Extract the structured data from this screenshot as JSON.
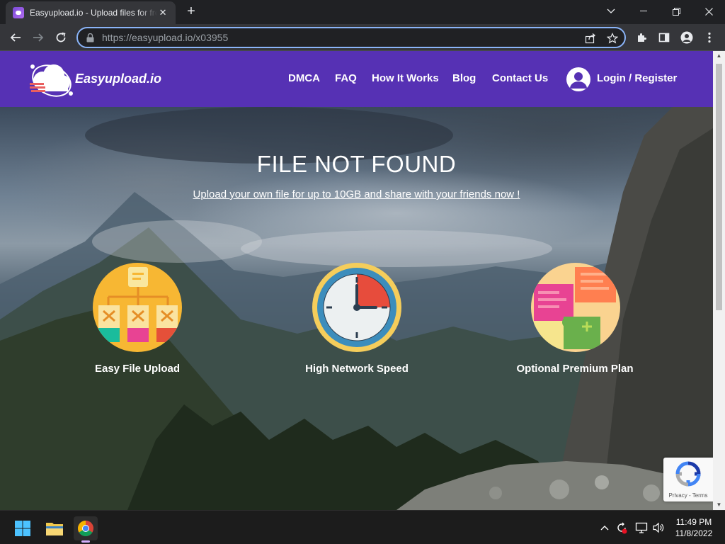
{
  "browser": {
    "tab_title": "Easyupload.io - Upload files for free",
    "tab_close": "✕",
    "new_tab": "+",
    "url_host": "https://easyupload.io",
    "url_path": "/x03955"
  },
  "site": {
    "logo_text": "Easyupload.io",
    "nav": {
      "dmca": "DMCA",
      "faq": "FAQ",
      "how": "How It Works",
      "blog": "Blog",
      "contact": "Contact Us",
      "login": "Login / Register"
    },
    "colors": {
      "header": "#5631b4",
      "accent": "#8ab4f8"
    }
  },
  "hero": {
    "title": "FILE NOT FOUND",
    "link": "Upload your own file for up to 10GB and share with your friends now !"
  },
  "features": [
    {
      "label": "Easy File Upload",
      "icon": "sitemap-icon"
    },
    {
      "label": "High Network Speed",
      "icon": "clock-icon"
    },
    {
      "label": "Optional Premium Plan",
      "icon": "puzzle-icon"
    }
  ],
  "recaptcha": {
    "text": "Privacy - Terms"
  },
  "taskbar": {
    "time": "11:49 PM",
    "date": "11/8/2022"
  }
}
